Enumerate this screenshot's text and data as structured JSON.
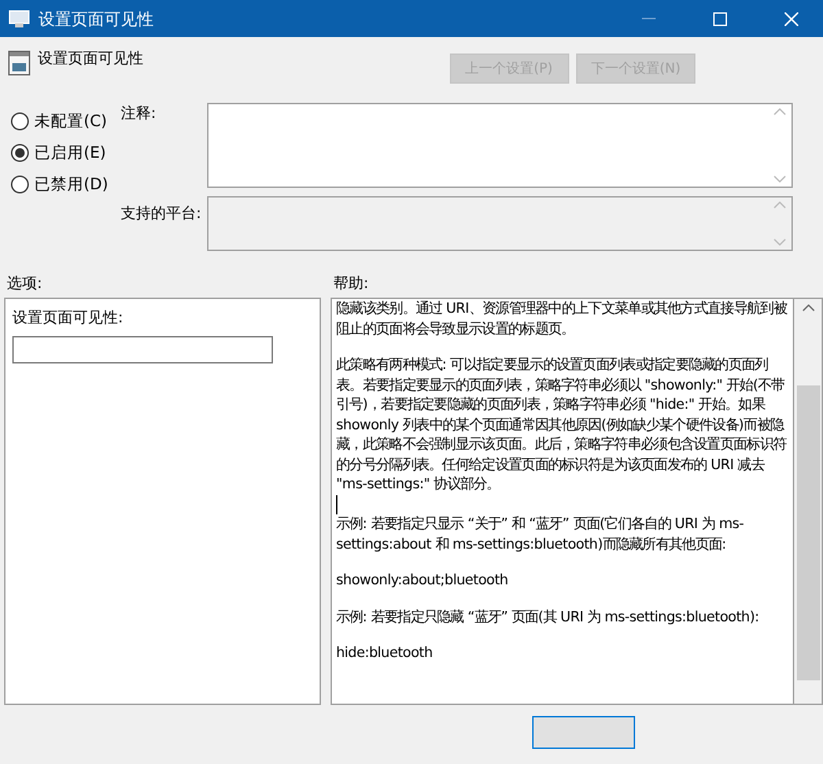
{
  "window": {
    "title": "设置页面可见性"
  },
  "header": {
    "title": "设置页面可见性",
    "buttons": [
      {
        "label": "上一个设置(P)",
        "disabled": true
      },
      {
        "label": "下一个设置(N)",
        "disabled": true
      }
    ]
  },
  "state_options": [
    {
      "label": "未配置(C)",
      "selected": false
    },
    {
      "label": "已启用(E)",
      "selected": true
    },
    {
      "label": "已禁用(D)",
      "selected": false
    }
  ],
  "comment": {
    "label": "注释:"
  },
  "supported_platforms": {
    "label": "支持的平台:"
  },
  "options": {
    "label": "选项:",
    "fields": [
      {
        "label": "设置页面可见性:"
      }
    ]
  },
  "help": {
    "label": "帮助:",
    "paragraphs": [
      {
        "kind": "text",
        "text": "隐藏该类别。通过 URI、资源管理器中的上下文菜单或其他方式直接导航到被阻止的页面将会导致显示设置的标题页。"
      },
      {
        "kind": "text",
        "text": "此策略有两种模式: 可以指定要显示的设置页面列表或指定要隐藏的页面列表。若要指定要显示的页面列表，策略字符串必须以 \"showonly:\" 开始(不带引号)，若要指定要隐藏的页面列表，策略字符串必须 \"hide:\" 开始。如果 showonly 列表中的某个页面通常因其他原因(例如缺少某个硬件设备)而被隐藏，此策略不会强制显示该页面。此后，策略字符串必须包含设置页面标识符的分号分隔列表。任何给定设置页面的标识符是为该页面发布的 URI 减去 \"ms-settings:\" 协议部分。"
      },
      {
        "kind": "cursor"
      },
      {
        "kind": "text",
        "text": "示例: 若要指定只显示 “关于” 和 “蓝牙” 页面(它们各自的 URI 为 ms-settings:about 和 ms-settings:bluetooth)而隐藏所有其他页面:"
      },
      {
        "kind": "text",
        "text": "showonly:about;bluetooth"
      },
      {
        "kind": "text",
        "text": "示例: 若要指定只隐藏 “蓝牙” 页面(其 URI 为 ms-settings:bluetooth):"
      },
      {
        "kind": "text",
        "text": "hide:bluetooth"
      }
    ]
  }
}
